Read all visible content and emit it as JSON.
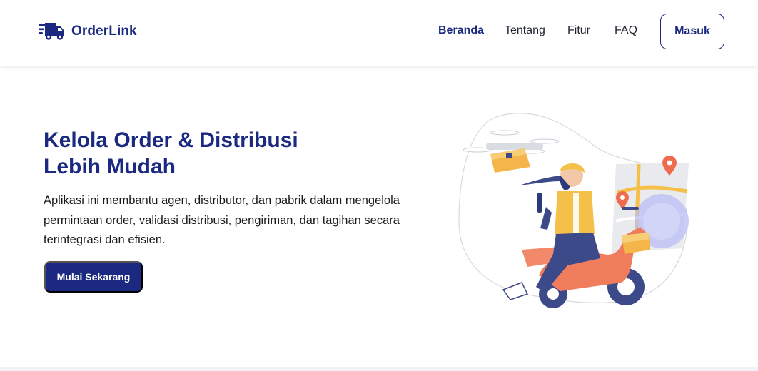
{
  "brand": {
    "name": "OrderLink",
    "icon": "delivery-truck-icon"
  },
  "nav": {
    "links": [
      {
        "label": "Beranda",
        "active": true
      },
      {
        "label": "Tentang",
        "active": false
      },
      {
        "label": "Fitur",
        "active": false
      },
      {
        "label": "FAQ",
        "active": false
      }
    ],
    "login_label": "Masuk"
  },
  "hero": {
    "title_line1": "Kelola Order & Distribusi",
    "title_line2": "Lebih Mudah",
    "description": "Aplikasi ini membantu agen, distributor, dan pabrik dalam mengelola permintaan order, validasi distribusi, pengiriman, dan tagihan secara terintegrasi dan efisien.",
    "cta_label": "Mulai Sekarang",
    "illustration": "courier-scooter-illustration"
  },
  "colors": {
    "primary": "#1b2a80",
    "accent_orange": "#ef7c5a",
    "accent_yellow": "#f5c04a",
    "accent_purple": "#b9bdf5"
  }
}
